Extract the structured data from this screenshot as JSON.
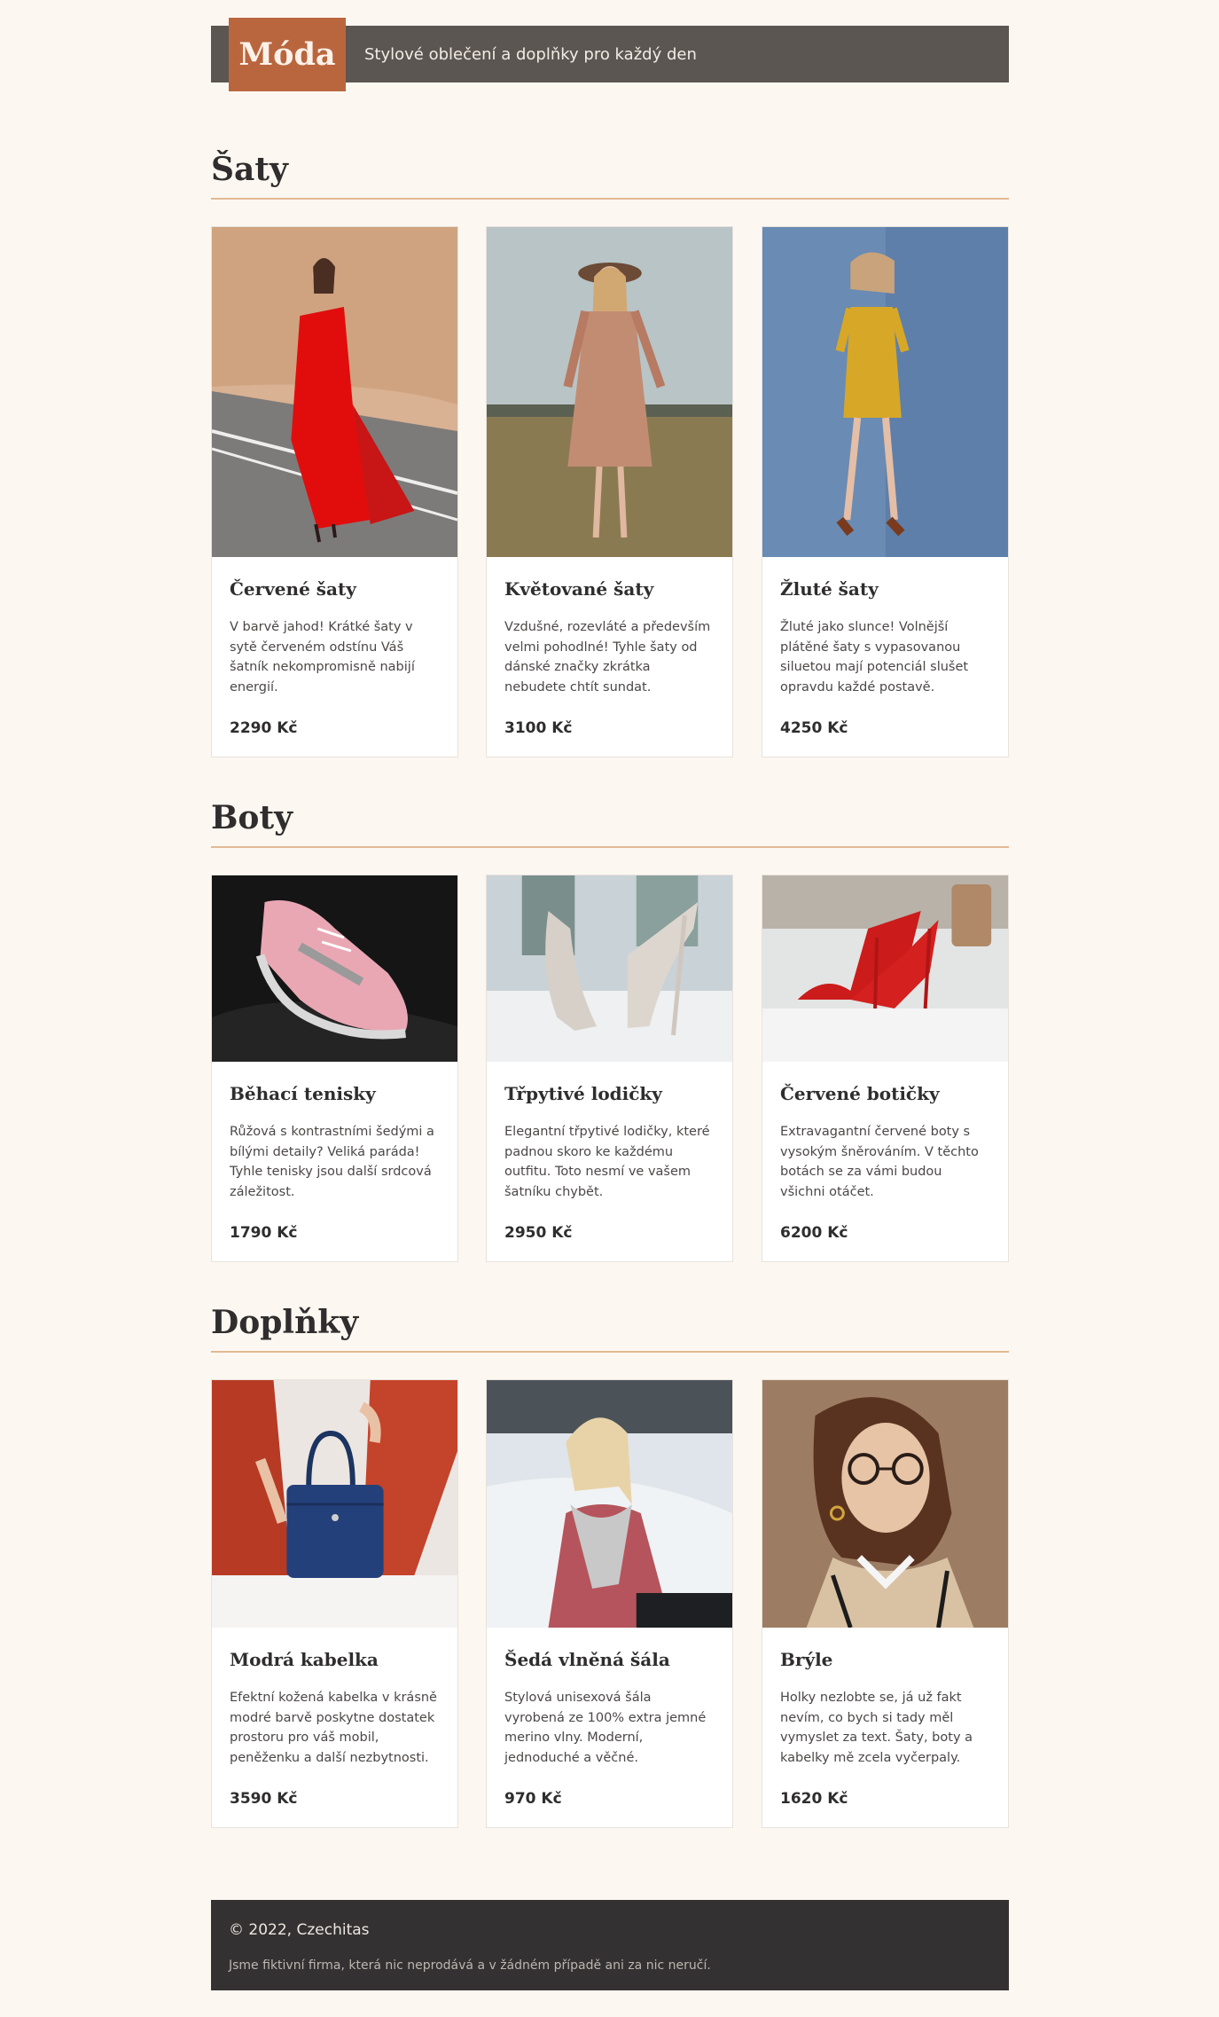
{
  "header": {
    "logo": "Móda",
    "tagline": "Stylové oblečení a doplňky pro každý den"
  },
  "sections": [
    {
      "title": "Šaty",
      "products": [
        {
          "name": "Červené šaty",
          "description": "V barvě jahod! Krátké šaty v sytě červeném odstínu Váš šatník nekompromisně nabijí energií.",
          "price": "2290 Kč",
          "image": "red-dress-photo"
        },
        {
          "name": "Květované šaty",
          "description": "Vzdušné, rozevláté a především velmi pohodlné! Tyhle šaty od dánské značky zkrátka nebudete chtít sundat.",
          "price": "3100 Kč",
          "image": "floral-dress-photo"
        },
        {
          "name": "Žluté šaty",
          "description": "Žluté jako slunce! Volnější plátěné šaty s vypasovanou siluetou mají potenciál slušet opravdu každé postavě.",
          "price": "4250 Kč",
          "image": "yellow-dress-photo"
        }
      ]
    },
    {
      "title": "Boty",
      "products": [
        {
          "name": "Běhací tenisky",
          "description": "Růžová s kontrastními šedými a bílými detaily? Veliká paráda! Tyhle tenisky jsou další srdcová záležitost.",
          "price": "1790 Kč",
          "image": "sneaker-photo"
        },
        {
          "name": "Třpytivé lodičky",
          "description": "Elegantní třpytivé lodičky, které padnou skoro ke každému outfitu. Toto nesmí ve vašem šatníku chybět.",
          "price": "2950 Kč",
          "image": "heels-photo"
        },
        {
          "name": "Červené botičky",
          "description": "Extravagantní červené boty s vysokým šněrováním. V těchto botách se za vámi budou všichni otáčet.",
          "price": "6200 Kč",
          "image": "red-shoes-photo"
        }
      ]
    },
    {
      "title": "Doplňky",
      "products": [
        {
          "name": "Modrá kabelka",
          "description": "Efektní kožená kabelka v krásně modré barvě poskytne dostatek prostoru pro váš mobil, peněženku a další nezbytnosti.",
          "price": "3590 Kč",
          "image": "handbag-photo"
        },
        {
          "name": "Šedá vlněná šála",
          "description": "Stylová unisexová šála vyrobená ze 100% extra jemné merino vlny. Moderní, jednoduché a věčné.",
          "price": "970 Kč",
          "image": "scarf-photo"
        },
        {
          "name": "Brýle",
          "description": "Holky nezlobte se, já už fakt nevím, co bych si tady měl vymyslet za text. Šaty, boty a kabelky mě zcela vyčerpaly.",
          "price": "1620 Kč",
          "image": "glasses-photo"
        }
      ]
    }
  ],
  "footer": {
    "copyright": "© 2022, Czechitas",
    "note": "Jsme fiktivní firma, která nic neprodává a v žádném případě ani za nic neručí."
  },
  "colors": {
    "background": "#fdf7f1",
    "header": "#5c5652",
    "logo": "#b9663f",
    "rule": "#e2b994",
    "footer": "#333131"
  }
}
